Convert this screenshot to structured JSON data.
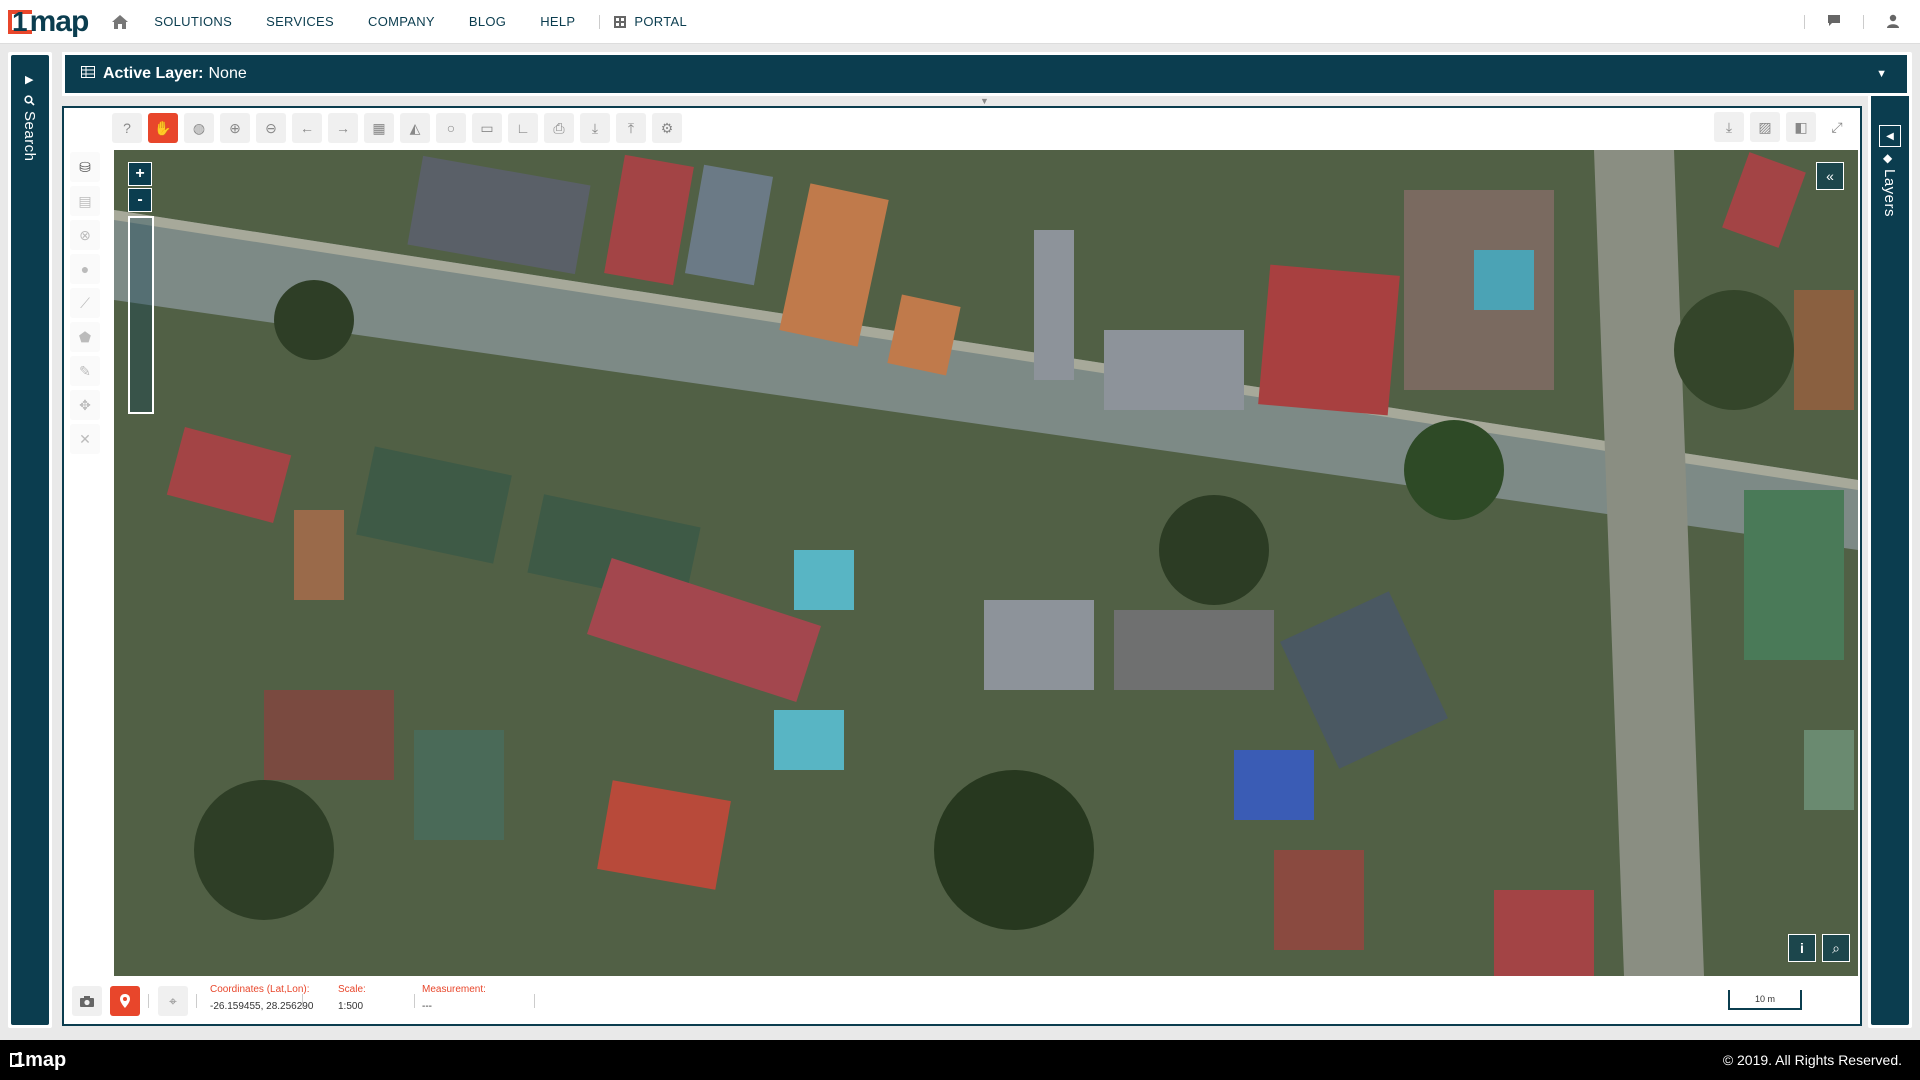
{
  "brand": {
    "logo_text": "map",
    "logo_num": "1",
    "footer_logo": "1map"
  },
  "nav": {
    "items": [
      "SOLUTIONS",
      "SERVICES",
      "COMPANY",
      "BLOG",
      "HELP"
    ],
    "portal_label": "PORTAL"
  },
  "side": {
    "left_label": "Search",
    "right_label": "Layers"
  },
  "layer_bar": {
    "prefix": "Active Layer:",
    "value": "None"
  },
  "toolbar": {
    "icons": [
      "help-icon",
      "pan-hand-icon",
      "globe-icon",
      "zoom-in-icon",
      "zoom-out-icon",
      "back-icon",
      "forward-icon",
      "grid-icon",
      "area-chart-icon",
      "circle-icon",
      "ruler-icon",
      "angle-icon",
      "print-icon",
      "download-icon",
      "upload-icon",
      "settings-icon"
    ],
    "right_icons": [
      "download-icon",
      "image-icon",
      "split-view-icon",
      "expand-icon"
    ]
  },
  "map": {
    "zoom_in": "+",
    "zoom_out": "-",
    "collapse": "«",
    "info": "i",
    "attach": "⌕"
  },
  "status": {
    "coord_label": "Coordinates (Lat,Lon):",
    "coord_value": "-26.159455, 28.256290",
    "scale_label": "Scale:",
    "scale_value": "1:500",
    "measure_label": "Measurement:",
    "measure_value": "---",
    "scalebar_text": "10 m"
  },
  "footer": {
    "copyright": "© 2019. All Rights Reserved."
  },
  "colors": {
    "primary": "#0b3d4f",
    "accent": "#e8462b"
  }
}
